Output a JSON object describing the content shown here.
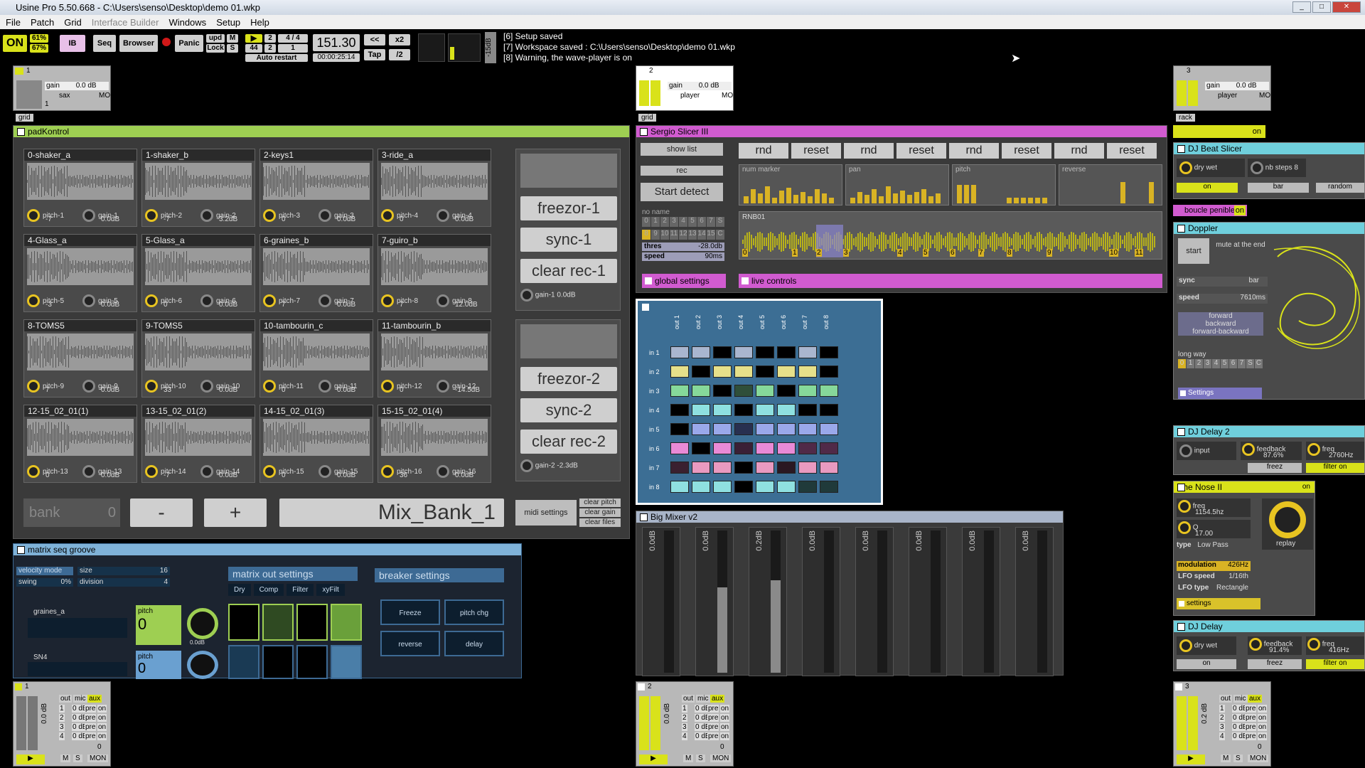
{
  "window": {
    "title": "Usine Pro 5.50.668 - C:\\Users\\senso\\Desktop\\demo 01.wkp"
  },
  "menu": [
    "File",
    "Patch",
    "Grid",
    "Interface Builder",
    "Windows",
    "Setup",
    "Help"
  ],
  "toolbar": {
    "on": "ON",
    "cpu1": "61%",
    "cpu2": "67%",
    "ib": "IB",
    "seq": "Seq",
    "browser": "Browser",
    "panic": "Panic",
    "upd": "upd",
    "lock": "Lock",
    "m": "M",
    "s": "S",
    "sig_top": "2",
    "sig_top2": "4 / 4",
    "sig_mid": "44",
    "sig_mid2": "2",
    "sig_mid3": "1",
    "auto_restart": "Auto restart",
    "bpm": "151.30",
    "time": "00:00:25:14",
    "rew": "<<",
    "x2": "x2",
    "tap": "Tap",
    "half": "/2",
    "db": "-15dB"
  },
  "log": [
    "[6] Setup saved",
    "[7] Workspace saved : C:\\Users\\senso\\Desktop\\demo 01.wkp",
    "[8] Warning, the wave-player is on"
  ],
  "racks": [
    {
      "num": "1",
      "gain": "gain",
      "gain_val": "0.0 dB",
      "name": "sax",
      "mon": "MON",
      "tag": "grid"
    },
    {
      "num": "2",
      "gain": "gain",
      "gain_val": "0.0 dB",
      "name": "player",
      "mon": "MON",
      "tag": "grid"
    },
    {
      "num": "3",
      "gain": "gain",
      "gain_val": "0.0 dB",
      "name": "player",
      "mon": "MON",
      "tag": "rack"
    }
  ],
  "rack_digits": [
    "1",
    "2",
    "3",
    "4",
    "5",
    "6",
    "7",
    "8"
  ],
  "padkontrol": {
    "title": "padKontrol",
    "pads": [
      {
        "name": "0-shaker_a",
        "p": "pitch-1",
        "pv": "-7",
        "g": "gain-1",
        "gv": "0.0dB"
      },
      {
        "name": "1-shaker_b",
        "p": "pitch-2",
        "pv": "-7",
        "g": "gain-2",
        "gv": "3.2dB"
      },
      {
        "name": "2-keys1",
        "p": "pitch-3",
        "pv": "0",
        "g": "gain-3",
        "gv": "0.0dB"
      },
      {
        "name": "3-ride_a",
        "p": "pitch-4",
        "pv": "0",
        "g": "gain-4",
        "gv": "0.0dB"
      },
      {
        "name": "4-Glass_a",
        "p": "pitch-5",
        "pv": "-3",
        "g": "gain-5",
        "gv": "0.0dB"
      },
      {
        "name": "5-Glass_a",
        "p": "pitch-6",
        "pv": "0",
        "g": "gain-6",
        "gv": "0.0dB"
      },
      {
        "name": "6-graines_b",
        "p": "pitch-7",
        "pv": "7",
        "g": "gain-7",
        "gv": "0.0dB"
      },
      {
        "name": "7-guiro_b",
        "p": "pitch-8",
        "pv": "7",
        "g": "gain-8",
        "gv": "12.0dB"
      },
      {
        "name": "8-TOMS5",
        "p": "pitch-9",
        "pv": "7",
        "g": "gain-9",
        "gv": "0.0dB"
      },
      {
        "name": "9-TOMS5",
        "p": "pitch-10",
        "pv": "33",
        "g": "gain-10",
        "gv": "0.0dB"
      },
      {
        "name": "10-tambourin_c",
        "p": "pitch-11",
        "pv": "0",
        "g": "gain-11",
        "gv": "0.0dB"
      },
      {
        "name": "11-tambourin_b",
        "p": "pitch-12",
        "pv": "0",
        "g": "gain-12",
        "gv": "-14.5dB"
      },
      {
        "name": "12-15_02_01(1)",
        "p": "pitch-13",
        "pv": "0",
        "g": "gain-13",
        "gv": "0.0dB"
      },
      {
        "name": "13-15_02_01(2)",
        "p": "pitch-14",
        "pv": "-7",
        "g": "gain-14",
        "gv": "0.0dB"
      },
      {
        "name": "14-15_02_01(3)",
        "p": "pitch-15",
        "pv": "0",
        "g": "gain-15",
        "gv": "0.0dB"
      },
      {
        "name": "15-15_02_01(4)",
        "p": "pitch-16",
        "pv": "36",
        "g": "gain-16",
        "gv": "0.0dB"
      }
    ],
    "freezor1": "freezor-1",
    "sync1": "sync-1",
    "clear1": "clear rec-1",
    "gain1": "gain-1",
    "gain1v": "0.0dB",
    "freezor2": "freezor-2",
    "sync2": "sync-2",
    "clear2": "clear rec-2",
    "gain2": "gain-2",
    "gain2v": "-2.3dB",
    "bank": "bank",
    "bank_val": "0",
    "minus": "-",
    "plus": "+",
    "bank_name": "Mix_Bank_1",
    "midi": "midi settings",
    "clear_pitch": "clear pitch",
    "clear_gain": "clear gain",
    "clear_files": "clear files"
  },
  "slicer": {
    "title": "Sergio Slicer III",
    "show_list": "show list",
    "rec": "rec",
    "start": "Start detect",
    "buttons": [
      "rnd",
      "reset",
      "rnd",
      "reset",
      "rnd",
      "reset",
      "rnd",
      "reset"
    ],
    "seq_labels": [
      "num marker",
      "pan",
      "pitch",
      "reverse"
    ],
    "no_name": "no name",
    "nums1": [
      "0",
      "1",
      "2",
      "3",
      "4",
      "5",
      "6",
      "7",
      "S"
    ],
    "nums2": [
      "8",
      "9",
      "10",
      "11",
      "12",
      "13",
      "14",
      "15",
      "C"
    ],
    "thres": "thres",
    "thres_v": "-28.0db",
    "speed": "speed",
    "speed_v": "90ms",
    "file": "RNB01",
    "markers": [
      "0",
      "1",
      "2",
      "3",
      "4",
      "5",
      "6",
      "7",
      "8",
      "9",
      "10",
      "11"
    ],
    "global": "global settings",
    "live": "live controls"
  },
  "matrix": {
    "outs": [
      "out 1",
      "out 2",
      "out 3",
      "out 4",
      "out 5",
      "out 6",
      "out 7",
      "out 8"
    ],
    "ins": [
      "in 1",
      "in 2",
      "in 3",
      "in 4",
      "in 5",
      "in 6",
      "in 7",
      "in 8"
    ],
    "colors": [
      [
        "#a9b6cf",
        "#a9b6cf",
        "#000",
        "#a9b6cf",
        "#000",
        "#000",
        "#a9b6cf",
        "#000"
      ],
      [
        "#e6e08a",
        "#000",
        "#e6e08a",
        "#e6e08a",
        "#000",
        "#e6e08a",
        "#e6e08a",
        "#000"
      ],
      [
        "#86d89a",
        "#86d89a",
        "#000",
        "#2f4f3a",
        "#86d89a",
        "#000",
        "#86d89a",
        "#86d89a"
      ],
      [
        "#000",
        "#8ee0e0",
        "#8ee0e0",
        "#000",
        "#8ee0e0",
        "#8ee0e0",
        "#000",
        "#000"
      ],
      [
        "#000",
        "#9aa8ea",
        "#9aa8ea",
        "#283050",
        "#9aa8ea",
        "#9aa8ea",
        "#9aa8ea",
        "#9aa8ea"
      ],
      [
        "#e98ad6",
        "#000",
        "#e98ad6",
        "#3a2036",
        "#e98ad6",
        "#e98ad6",
        "#502a48",
        "#502a48"
      ],
      [
        "#3a2030",
        "#e99ac0",
        "#e99ac0",
        "#000",
        "#e99ac0",
        "#2a1822",
        "#e99ac0",
        "#e99ac0"
      ],
      [
        "#8fe0e0",
        "#8fe0e0",
        "#8fe0e0",
        "#000",
        "#8fe0e0",
        "#8fe0e0",
        "#203a3a",
        "#203a3a"
      ]
    ]
  },
  "mixer": {
    "title": "Big Mixer v2",
    "values": [
      "0.0dB",
      "0.0dB",
      "0.2dB",
      "0.0dB",
      "0.0dB",
      "0.0dB",
      "0.0dB",
      "0.0dB"
    ],
    "levels": [
      0,
      0.6,
      0.65,
      0,
      0,
      0,
      0,
      0
    ]
  },
  "seqgroove": {
    "title": "matrix seq groove",
    "velocity": "velocity mode",
    "size": "size",
    "size_v": "16",
    "swing": "swing",
    "swing_v": "0%",
    "division": "division",
    "division_v": "4",
    "graines": "graines_a",
    "sn4": "SN4",
    "pitch": "pitch",
    "pitch_v": "0",
    "pitch2": "pitch",
    "pitch2_v": "0",
    "knob_v": "0.0dB",
    "mo_settings": "matrix out settings",
    "tabs": [
      "Dry",
      "Comp",
      "Filter",
      "xyFilt"
    ],
    "breaker": "breaker settings",
    "freeze": "Freeze",
    "pitchchg": "pitch chg",
    "reverse": "reverse",
    "delay": "delay"
  },
  "right": {
    "on_label": "on",
    "beat_slicer": "DJ Beat Slicer",
    "drywet": "dry wet",
    "nbsteps": "nb steps",
    "nbsteps_v": "8",
    "on": "on",
    "bar": "bar",
    "random": "random",
    "boucle": "boucle penible",
    "boucle_on": "on",
    "doppler": "Doppler",
    "start": "start",
    "mute_end": "mute at the end",
    "sync": "sync",
    "sync_v": "bar",
    "speed": "speed",
    "speed_v": "7610ms",
    "forward": "forward",
    "backward": "backward",
    "fb": "forward-backward",
    "longway": "long way",
    "lw": [
      "0",
      "1",
      "2",
      "3",
      "4",
      "5",
      "6",
      "7",
      "S",
      "C"
    ],
    "settings": "Settings",
    "delay2": "DJ Delay 2",
    "input": "input",
    "feedback": "feedback",
    "feedback_v": "87.6%",
    "freq": "freq",
    "freq_v": "2760Hz",
    "freez": "freez",
    "filter_on": "filter on",
    "nose": "the Nose II",
    "nose_on": "on",
    "nfreq": "freq",
    "nfreq_v": "1154.5hz",
    "q": "Q",
    "q_v": "17.00",
    "type": "type",
    "type_v": "Low Pass",
    "replay": "replay",
    "modulation": "modulation",
    "mod_v": "426Hz",
    "lfo_speed": "LFO speed",
    "lfo_speed_v": "1/16th",
    "lfo_type": "LFO type",
    "lfo_type_v": "Rectangle",
    "nsettings": "settings",
    "djdelay": "DJ Delay",
    "d_drywet": "dry wet",
    "d_feedback": "feedback",
    "d_feedback_v": "91.4%",
    "d_freq": "freq",
    "d_freq_v": "416Hz",
    "d_on": "on",
    "d_freez": "freez",
    "d_filter": "filter on"
  },
  "bottom_racks": [
    {
      "num": "1",
      "db": "0.0 dB"
    },
    {
      "num": "2",
      "db": "0.0 dB"
    },
    {
      "num": "3",
      "db": "0.2 dB"
    }
  ],
  "bottom_rows": [
    [
      "1",
      "0 dB",
      "pre",
      "on"
    ],
    [
      "2",
      "0 dB",
      "pre",
      "on"
    ],
    [
      "3",
      "0 dB",
      "pre",
      "on"
    ],
    [
      "4",
      "0 dB",
      "pre",
      "on"
    ]
  ],
  "bottom_head": [
    "out",
    "mic",
    "aux"
  ],
  "bottom_m": "M",
  "bottom_s": "S",
  "bottom_mon": "MON",
  "bottom_zero": "0"
}
